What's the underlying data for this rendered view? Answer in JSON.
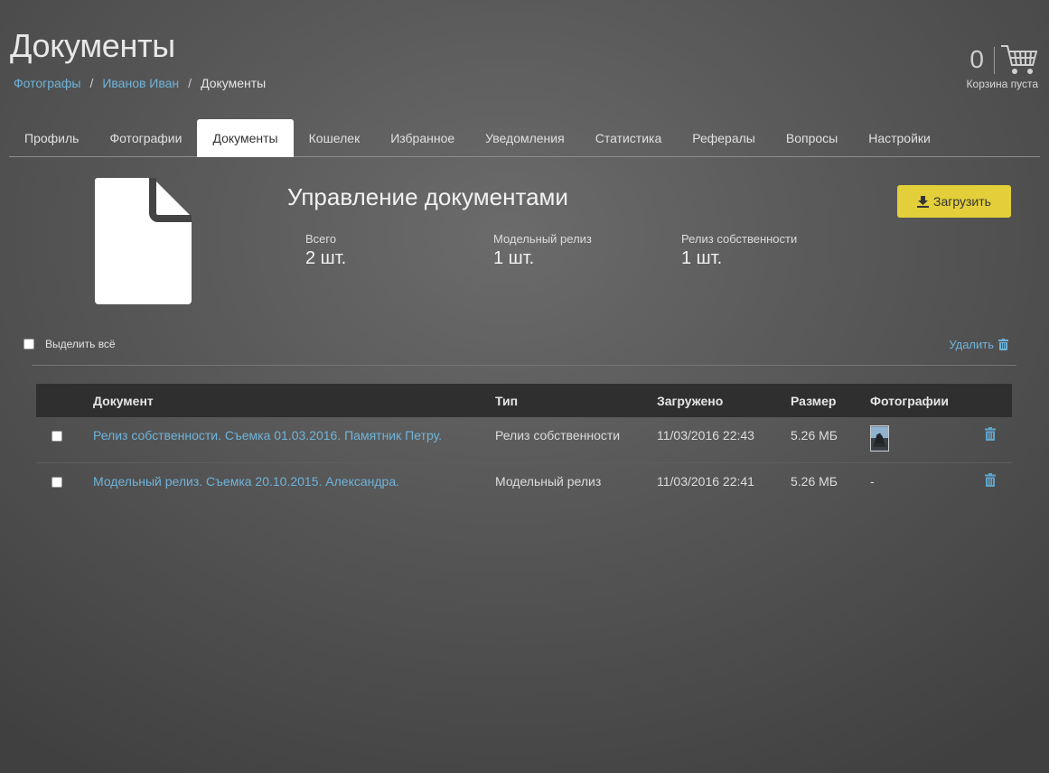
{
  "header": {
    "title": "Документы",
    "breadcrumbs": [
      {
        "label": "Фотографы"
      },
      {
        "label": "Иванов Иван"
      },
      {
        "label": "Документы"
      }
    ],
    "separator": "/"
  },
  "cart": {
    "count": "0",
    "label": "Корзина пуста"
  },
  "tabs": [
    {
      "label": "Профиль"
    },
    {
      "label": "Фотографии"
    },
    {
      "label": "Документы",
      "active": true
    },
    {
      "label": "Кошелек"
    },
    {
      "label": "Избранное"
    },
    {
      "label": "Уведомления"
    },
    {
      "label": "Статистика"
    },
    {
      "label": "Рефералы"
    },
    {
      "label": "Вопросы"
    },
    {
      "label": "Настройки"
    }
  ],
  "summary": {
    "title": "Управление документами",
    "upload_label": "Загрузить",
    "stats": [
      {
        "label": "Всего",
        "value": "2 шт."
      },
      {
        "label": "Модельный релиз",
        "value": "1 шт."
      },
      {
        "label": "Релиз собственности",
        "value": "1 шт."
      }
    ]
  },
  "toolbar": {
    "select_all_label": "Выделить всё",
    "delete_label": "Удалить"
  },
  "table": {
    "columns": [
      "Документ",
      "Тип",
      "Загружено",
      "Размер",
      "Фотографии"
    ],
    "rows": [
      {
        "document": "Релиз собственности. Съемка 01.03.2016. Памятник Петру.",
        "type": "Релиз собственности",
        "uploaded": "11/03/2016 22:43",
        "size": "5.26 МБ",
        "photos": ""
      },
      {
        "document": "Модельный релиз. Съемка 20.10.2015. Александра.",
        "type": "Модельный релиз",
        "uploaded": "11/03/2016 22:41",
        "size": "5.26 МБ",
        "photos": "-"
      }
    ]
  },
  "colors": {
    "accent_link": "#6fb3d9",
    "upload_button": "#e3cf3a",
    "table_header": "#2f2f2f"
  },
  "icons": [
    "cart-icon",
    "document-icon",
    "download-icon",
    "trash-icon"
  ]
}
